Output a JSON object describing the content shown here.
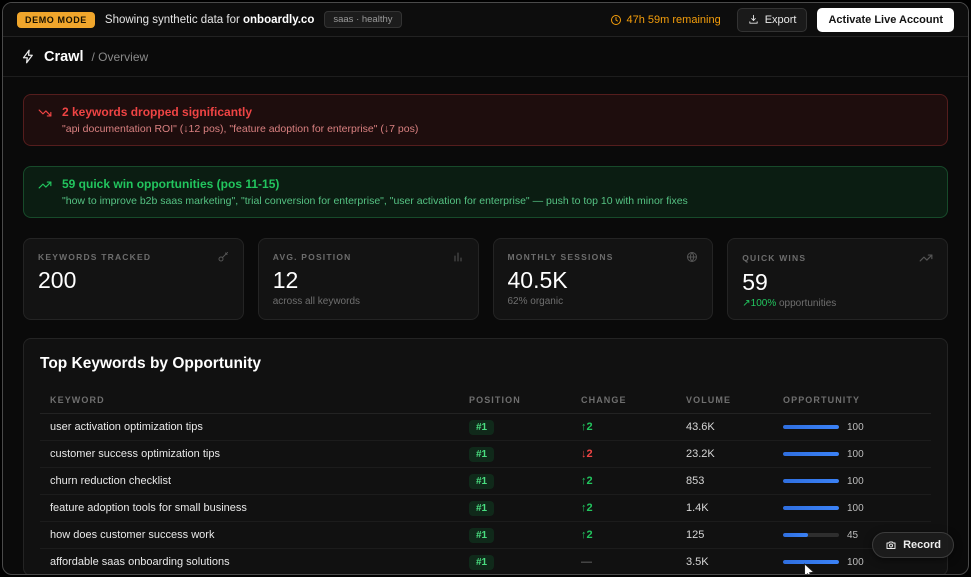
{
  "banner": {
    "demo_badge": "DEMO MODE",
    "text_prefix": "Showing synthetic data for",
    "domain": "onboardly.co",
    "tag": "saas · healthy",
    "time_remaining": "47h 59m remaining",
    "export_label": "Export",
    "activate_label": "Activate Live Account"
  },
  "header": {
    "title": "Crawl",
    "breadcrumb": "/ Overview"
  },
  "alerts": {
    "drop": {
      "title": "2 keywords dropped significantly",
      "detail": "\"api documentation ROI\" (↓12 pos), \"feature adoption for enterprise\" (↓7 pos)"
    },
    "quickwin": {
      "title": "59 quick win opportunities (pos 11-15)",
      "detail": "\"how to improve b2b saas marketing\", \"trial conversion for enterprise\", \"user activation for enterprise\" — push to top 10 with minor fixes"
    }
  },
  "stats": [
    {
      "id": "keywords-tracked",
      "label": "KEYWORDS TRACKED",
      "icon": "key-icon",
      "value": "200",
      "sub": ""
    },
    {
      "id": "avg-position",
      "label": "AVG. POSITION",
      "icon": "bar-chart-icon",
      "value": "12",
      "sub": "across all keywords"
    },
    {
      "id": "monthly-sessions",
      "label": "MONTHLY SESSIONS",
      "icon": "globe-icon",
      "value": "40.5K",
      "sub": "62% organic"
    },
    {
      "id": "quick-wins",
      "label": "QUICK WINS",
      "icon": "trend-up-icon",
      "value": "59",
      "sub_accent": "↗100%",
      "sub": "opportunities"
    }
  ],
  "table": {
    "title": "Top Keywords by Opportunity",
    "columns": [
      "KEYWORD",
      "POSITION",
      "CHANGE",
      "VOLUME",
      "OPPORTUNITY"
    ],
    "rows": [
      {
        "keyword": "user activation optimization tips",
        "position": "#1",
        "change": "↑2",
        "change_dir": "up",
        "volume": "43.6K",
        "opportunity": 100
      },
      {
        "keyword": "customer success optimization tips",
        "position": "#1",
        "change": "↓2",
        "change_dir": "down",
        "volume": "23.2K",
        "opportunity": 100
      },
      {
        "keyword": "churn reduction checklist",
        "position": "#1",
        "change": "↑2",
        "change_dir": "up",
        "volume": "853",
        "opportunity": 100
      },
      {
        "keyword": "feature adoption tools for small business",
        "position": "#1",
        "change": "↑2",
        "change_dir": "up",
        "volume": "1.4K",
        "opportunity": 100
      },
      {
        "keyword": "how does customer success work",
        "position": "#1",
        "change": "↑2",
        "change_dir": "up",
        "volume": "125",
        "opportunity": 45
      },
      {
        "keyword": "affordable saas onboarding solutions",
        "position": "#1",
        "change": "—",
        "change_dir": "flat",
        "volume": "3.5K",
        "opportunity": 100
      }
    ]
  },
  "record_label": "Record",
  "icons": {
    "clock": "clock-icon",
    "download": "download-icon",
    "bolt": "crawl-bolt-icon",
    "trend_down": "trend-down-icon",
    "trend_up": "trend-up-icon",
    "camera": "camera-icon",
    "cursor": "cursor-icon"
  },
  "colors": {
    "accent_amber": "#f59e0b",
    "accent_green": "#22c55e",
    "accent_red": "#ef4444",
    "accent_blue": "#3b82f6"
  }
}
